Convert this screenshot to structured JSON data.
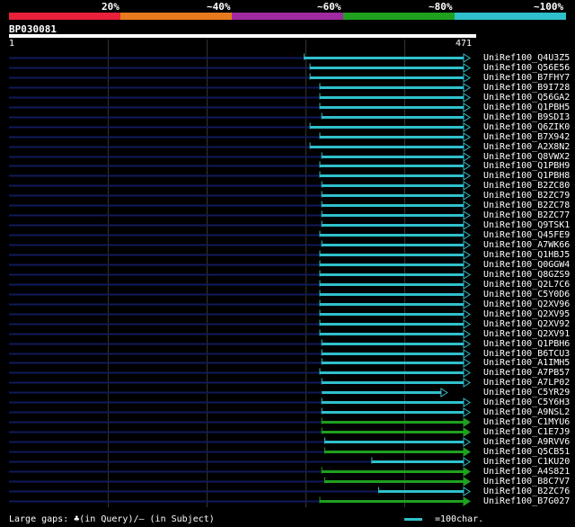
{
  "legend": {
    "labels": [
      "20%",
      "~40%",
      "~60%",
      "~80%",
      "~100%"
    ],
    "colors": [
      "#e8203a",
      "#e87a1e",
      "#a02aa0",
      "#1fa01f",
      "#2fc0cc"
    ]
  },
  "query": {
    "name": "BP030081",
    "start": "1",
    "end": "471",
    "length": 471
  },
  "colors": {
    "gap": "#101a5a",
    "cyan": "#2fc0cc",
    "green": "#1fa01f",
    "query_bar": "#ffffff"
  },
  "hits": [
    {
      "label": "UniRef100_Q4U3Z5",
      "start": 302,
      "end": 471,
      "color": "cyan",
      "arrow": true,
      "tick": true
    },
    {
      "label": "UniRef100_Q56E56",
      "start": 308,
      "end": 471,
      "color": "cyan",
      "arrow": true,
      "tick": true
    },
    {
      "label": "UniRef100_B7FHY7",
      "start": 308,
      "end": 471,
      "color": "cyan",
      "arrow": true,
      "tick": true
    },
    {
      "label": "UniRef100_B9I728",
      "start": 318,
      "end": 471,
      "color": "cyan",
      "arrow": true,
      "tick": true
    },
    {
      "label": "UniRef100_Q56GA2",
      "start": 318,
      "end": 471,
      "color": "cyan",
      "arrow": true,
      "tick": true
    },
    {
      "label": "UniRef100_Q1PBH5",
      "start": 318,
      "end": 471,
      "color": "cyan",
      "arrow": true,
      "tick": true
    },
    {
      "label": "UniRef100_B9SDI3",
      "start": 320,
      "end": 471,
      "color": "cyan",
      "arrow": true,
      "tick": true
    },
    {
      "label": "UniRef100_Q6ZIK0",
      "start": 308,
      "end": 471,
      "color": "cyan",
      "arrow": true,
      "tick": true
    },
    {
      "label": "UniRef100_B7X942",
      "start": 318,
      "end": 471,
      "color": "cyan",
      "arrow": true,
      "tick": true
    },
    {
      "label": "UniRef100_A2X8N2",
      "start": 308,
      "end": 471,
      "color": "cyan",
      "arrow": true,
      "tick": true
    },
    {
      "label": "UniRef100_Q8VWX2",
      "start": 320,
      "end": 471,
      "color": "cyan",
      "arrow": true,
      "tick": true
    },
    {
      "label": "UniRef100_Q1PBH9",
      "start": 318,
      "end": 471,
      "color": "cyan",
      "arrow": true,
      "tick": true
    },
    {
      "label": "UniRef100_Q1PBH8",
      "start": 318,
      "end": 471,
      "color": "cyan",
      "arrow": true,
      "tick": true
    },
    {
      "label": "UniRef100_B2ZC80",
      "start": 320,
      "end": 471,
      "color": "cyan",
      "arrow": true,
      "tick": true
    },
    {
      "label": "UniRef100_B2ZC79",
      "start": 320,
      "end": 471,
      "color": "cyan",
      "arrow": true,
      "tick": true
    },
    {
      "label": "UniRef100_B2ZC78",
      "start": 320,
      "end": 471,
      "color": "cyan",
      "arrow": true,
      "tick": true
    },
    {
      "label": "UniRef100_B2ZC77",
      "start": 320,
      "end": 471,
      "color": "cyan",
      "arrow": true,
      "tick": true
    },
    {
      "label": "UniRef100_Q9TSK1",
      "start": 320,
      "end": 471,
      "color": "cyan",
      "arrow": true,
      "tick": true
    },
    {
      "label": "UniRef100_Q45FE9",
      "start": 318,
      "end": 471,
      "color": "cyan",
      "arrow": true,
      "tick": true
    },
    {
      "label": "UniRef100_A7WK66",
      "start": 320,
      "end": 471,
      "color": "cyan",
      "arrow": true,
      "tick": true
    },
    {
      "label": "UniRef100_Q1HBJ5",
      "start": 318,
      "end": 471,
      "color": "cyan",
      "arrow": true,
      "tick": true
    },
    {
      "label": "UniRef100_Q0GGW4",
      "start": 318,
      "end": 471,
      "color": "cyan",
      "arrow": true,
      "tick": true
    },
    {
      "label": "UniRef100_Q8GZS9",
      "start": 318,
      "end": 471,
      "color": "cyan",
      "arrow": true,
      "tick": true
    },
    {
      "label": "UniRef100_Q2L7C6",
      "start": 318,
      "end": 471,
      "color": "cyan",
      "arrow": true,
      "tick": true
    },
    {
      "label": "UniRef100_C5Y0D6",
      "start": 318,
      "end": 471,
      "color": "cyan",
      "arrow": true,
      "tick": true
    },
    {
      "label": "UniRef100_Q2XV96",
      "start": 318,
      "end": 471,
      "color": "cyan",
      "arrow": true,
      "tick": true
    },
    {
      "label": "UniRef100_Q2XV95",
      "start": 318,
      "end": 471,
      "color": "cyan",
      "arrow": true,
      "tick": true
    },
    {
      "label": "UniRef100_Q2XV92",
      "start": 318,
      "end": 471,
      "color": "cyan",
      "arrow": true,
      "tick": true
    },
    {
      "label": "UniRef100_Q2XV91",
      "start": 318,
      "end": 471,
      "color": "cyan",
      "arrow": true,
      "tick": true
    },
    {
      "label": "UniRef100_Q1PBH6",
      "start": 320,
      "end": 471,
      "color": "cyan",
      "arrow": true,
      "tick": true
    },
    {
      "label": "UniRef100_B6TCU3",
      "start": 320,
      "end": 471,
      "color": "cyan",
      "arrow": true,
      "tick": true
    },
    {
      "label": "UniRef100_A1IMH5",
      "start": 320,
      "end": 471,
      "color": "cyan",
      "arrow": true,
      "tick": true
    },
    {
      "label": "UniRef100_A7PB57",
      "start": 318,
      "end": 471,
      "color": "cyan",
      "arrow": true,
      "tick": true
    },
    {
      "label": "UniRef100_A7LP02",
      "start": 320,
      "end": 471,
      "color": "cyan",
      "arrow": true,
      "tick": true
    },
    {
      "label": "UniRef100_C5YR29",
      "start": 320,
      "end": 448,
      "color": "cyan",
      "arrow": true,
      "tick": false
    },
    {
      "label": "UniRef100_C5Y6H3",
      "start": 320,
      "end": 471,
      "color": "cyan",
      "arrow": true,
      "tick": true
    },
    {
      "label": "UniRef100_A9NSL2",
      "start": 320,
      "end": 471,
      "color": "cyan",
      "arrow": true,
      "tick": true
    },
    {
      "label": "UniRef100_C1MYU6",
      "start": 320,
      "end": 471,
      "color": "green",
      "arrow": true,
      "tick": true
    },
    {
      "label": "UniRef100_C1E7J9",
      "start": 320,
      "end": 471,
      "color": "green",
      "arrow": true,
      "tick": true
    },
    {
      "label": "UniRef100_A9RVV6",
      "start": 323,
      "end": 471,
      "color": "cyan",
      "arrow": true,
      "tick": true
    },
    {
      "label": "UniRef100_Q5CB51",
      "start": 323,
      "end": 471,
      "color": "green",
      "arrow": true,
      "tick": true
    },
    {
      "label": "UniRef100_C1KU20",
      "start": 371,
      "end": 471,
      "color": "cyan",
      "arrow": true,
      "tick": true
    },
    {
      "label": "UniRef100_A4S821",
      "start": 320,
      "end": 471,
      "color": "green",
      "arrow": true,
      "tick": true
    },
    {
      "label": "UniRef100_B8C7V7",
      "start": 323,
      "end": 471,
      "color": "green",
      "arrow": true,
      "tick": true
    },
    {
      "label": "UniRef100_B2ZC76",
      "start": 378,
      "end": 471,
      "color": "cyan",
      "arrow": true,
      "tick": true
    },
    {
      "label": "UniRef100_B7G027",
      "start": 318,
      "end": 471,
      "color": "green",
      "arrow": true,
      "tick": true
    }
  ],
  "footer": {
    "large_gaps": "Large gaps: ♣(in Query)/— (in Subject)",
    "scale_text": "=100char."
  }
}
